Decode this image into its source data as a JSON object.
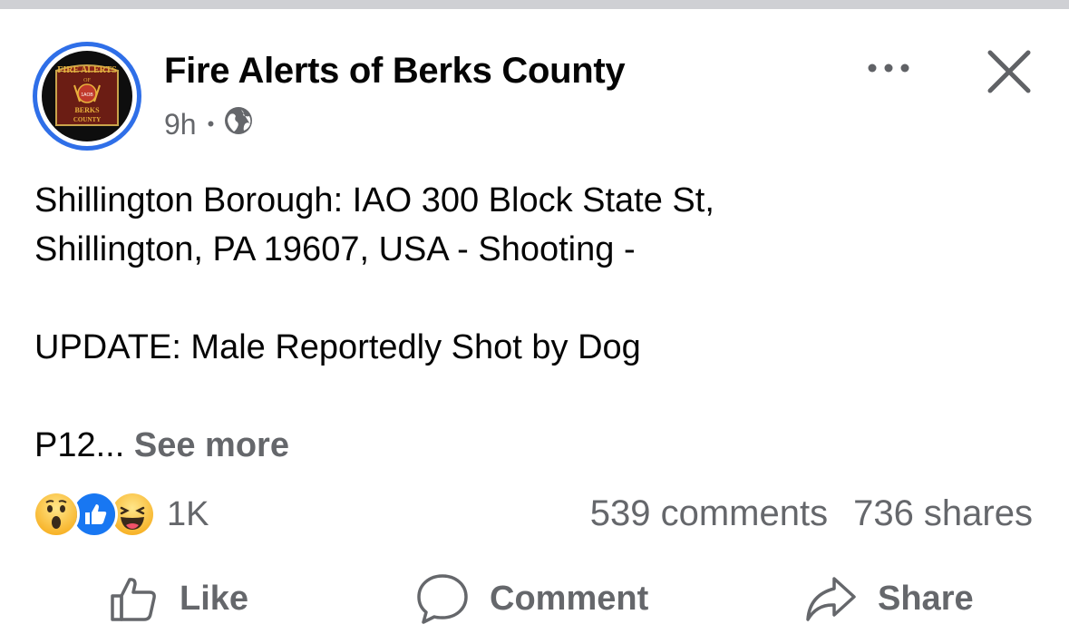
{
  "post": {
    "page_name": "Fire Alerts of Berks County",
    "time": "9h",
    "privacy_icon": "globe-icon",
    "avatar_text": {
      "top": "FIRE ALERTS",
      "middle": "OF",
      "bottom1": "BERKS",
      "bottom2": "COUNTY",
      "badge": "1AOB"
    },
    "lines": [
      "Shillington Borough: IAO 300 Block State St,",
      "Shillington, PA 19607, USA - Shooting -",
      "",
      "UPDATE: Male Reportedly Shot by Dog",
      ""
    ],
    "truncated": "P12...",
    "see_more": "See more"
  },
  "reactions": {
    "icons": [
      "wow-icon",
      "like-icon",
      "haha-icon"
    ],
    "count": "1K",
    "comments": "539 comments",
    "shares": "736 shares"
  },
  "actions": {
    "like": "Like",
    "comment": "Comment",
    "share": "Share"
  },
  "colors": {
    "avatar_ring": "#2f6fe8",
    "like_blue": "#1877f2",
    "secondary_text": "#65676b"
  }
}
